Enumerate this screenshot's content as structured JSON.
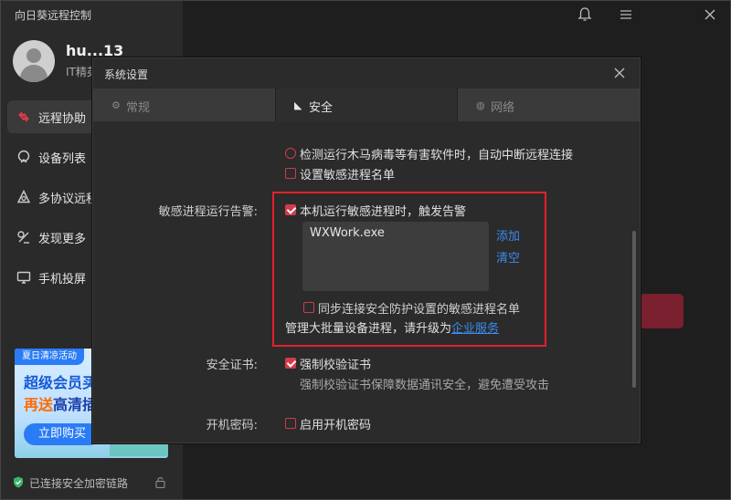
{
  "app": {
    "title": "向日葵远程控制"
  },
  "window_controls": {
    "bell": "bell-icon",
    "menu": "menu-icon",
    "close": "close-icon"
  },
  "user": {
    "name": "hu...13",
    "subtitle": "IT精英"
  },
  "nav": {
    "items": [
      {
        "label": "远程协助",
        "icon": "remote-assist-icon",
        "active": true
      },
      {
        "label": "设备列表",
        "icon": "device-list-icon",
        "active": false
      },
      {
        "label": "多协议远程",
        "icon": "multi-protocol-icon",
        "active": false
      },
      {
        "label": "发现更多",
        "icon": "discover-icon",
        "active": false
      },
      {
        "label": "手机投屏",
        "icon": "screen-cast-icon",
        "active": false
      }
    ]
  },
  "promo": {
    "tag": "夏日清凉活动",
    "line1": "超级会员买",
    "line2_prefix": "再送",
    "line2_rest": "高清插",
    "button": "立即购买"
  },
  "status": {
    "text": "已连接安全加密链路"
  },
  "dialog": {
    "title": "系统设置",
    "tabs": [
      {
        "label": "常规",
        "icon": "gear-icon",
        "active": false
      },
      {
        "label": "安全",
        "icon": "shield-icon",
        "active": true
      },
      {
        "label": "网络",
        "icon": "globe-icon",
        "active": false
      }
    ],
    "security": {
      "trojan_option": "检测运行木马病毒等有害软件时，自动中断远程连接",
      "sensitive_list_option": "设置敏感进程名单",
      "alert_label": "敏感进程运行告警:",
      "alert_option": "本机运行敏感进程时，触发告警",
      "process_list": [
        "WXWork.exe"
      ],
      "add_label": "添加",
      "clear_label": "清空",
      "sync_option": "同步连接安全防护设置的敏感进程名单",
      "upgrade_text": "管理大批量设备进程，请升级为",
      "upgrade_link": "企业服务",
      "cert_label": "安全证书:",
      "cert_option": "强制校验证书",
      "cert_desc": "强制校验证书保障数据通讯安全，避免遭受攻击",
      "boot_label": "开机密码:",
      "boot_option": "启用开机密码"
    }
  },
  "colors": {
    "accent": "#d23b4a",
    "link": "#3d8bf0",
    "highlight": "#e5202e"
  }
}
